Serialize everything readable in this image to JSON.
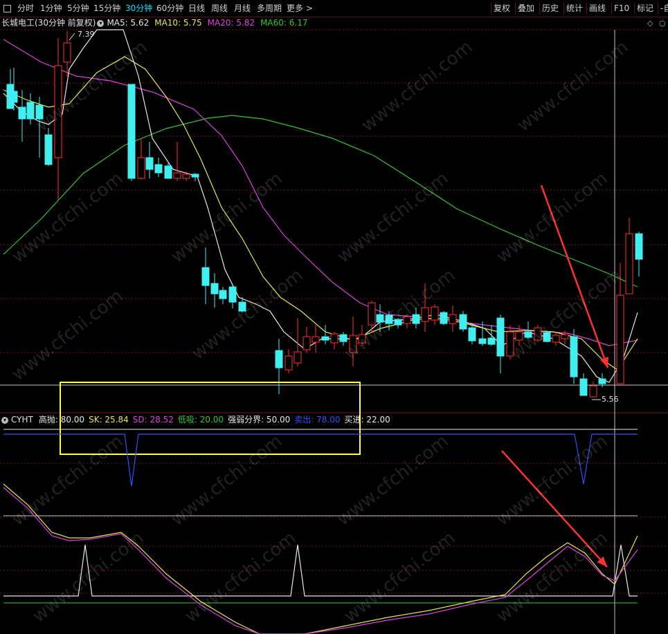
{
  "toolbar": {
    "tabs": [
      "分时",
      "1分钟",
      "5分钟",
      "15分钟",
      "30分钟",
      "60分钟",
      "日线",
      "周线",
      "月线",
      "多周期",
      "更多 >"
    ],
    "active_tab": "30分钟",
    "right_buttons": [
      "复权",
      "叠加",
      "历史",
      "统计",
      "画线",
      "F10",
      "标记",
      "-自"
    ]
  },
  "main_legend": {
    "stock": "长城电工(30分钟 前复权)",
    "ma": [
      {
        "label": "MA5: 5.62",
        "color": "#e8e8e8"
      },
      {
        "label": "MA10: 5.75",
        "color": "#e8e84a"
      },
      {
        "label": "MA20: 5.82",
        "color": "#e040e0"
      },
      {
        "label": "MA60: 6.17",
        "color": "#30c830"
      }
    ]
  },
  "annotations": {
    "high": "7.39",
    "low": "5.56"
  },
  "indicator_legend": {
    "name": "CYHT",
    "items": [
      {
        "label": "高抛: 80.00",
        "color": "#e8e8e8"
      },
      {
        "label": "SK: 25.84",
        "color": "#e8e84a"
      },
      {
        "label": "SD: 28.52",
        "color": "#e040e0"
      },
      {
        "label": "低吸: 20.00",
        "color": "#30c830"
      },
      {
        "label": "强弱分界: 50.00",
        "color": "#e8e8e8"
      },
      {
        "label": "卖出: 78.00",
        "color": "#3050ff"
      },
      {
        "label": "买进: 22.00",
        "color": "#e8e8e8"
      }
    ]
  },
  "watermark": "www.cfchi.com",
  "colors": {
    "up": "#ff3030",
    "down": "#40f0f0",
    "grid": "#7a1a1a",
    "arrow": "#ff3030",
    "highlight": "#ffff40"
  }
}
